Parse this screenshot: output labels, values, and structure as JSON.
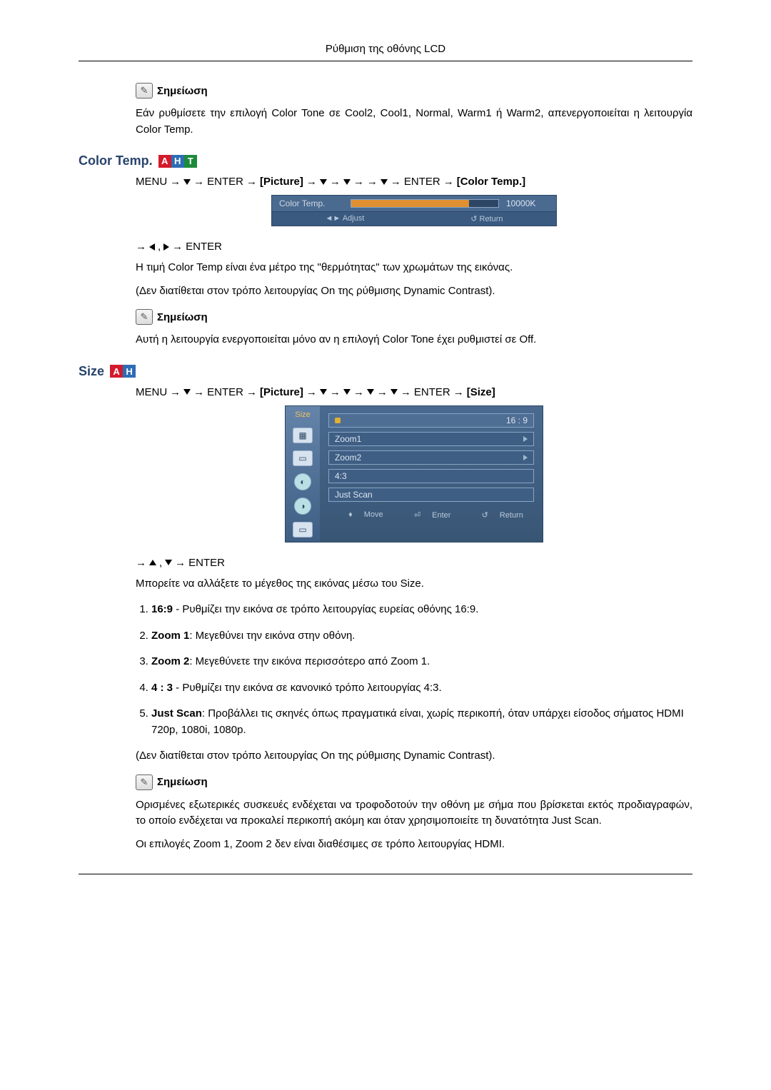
{
  "page_header": "Ρύθμιση της οθόνης LCD",
  "note_label": "Σημείωση",
  "note1_text": "Εάν ρυθμίσετε την επιλογή Color Tone σε Cool2, Cool1, Normal, Warm1 ή Warm2, απενεργοποιείται η λειτουργία Color Temp.",
  "section_colortemp": {
    "title": "Color Temp.",
    "nav": {
      "menu": "MENU",
      "enter": "ENTER",
      "picture": "Picture",
      "target": "Color Temp."
    },
    "osd": {
      "label": "Color  Temp.",
      "value": "10000K",
      "adjust": "Adjust",
      "return": "Return"
    },
    "after_nav": "ENTER",
    "desc": "Η τιμή Color Temp είναι ένα μέτρο της \"θερμότητας\" των χρωμάτων της εικόνας.",
    "restriction": "(Δεν διατίθεται στον τρόπο λειτουργίας On της ρύθμισης Dynamic Contrast).",
    "note2_text": "Αυτή η λειτουργία ενεργοποιείται μόνο αν η επιλογή Color Tone έχει ρυθμιστεί σε Off."
  },
  "section_size": {
    "title": "Size",
    "nav": {
      "menu": "MENU",
      "enter": "ENTER",
      "picture": "Picture",
      "target": "Size"
    },
    "osd": {
      "side_title": "Size",
      "options": [
        "16 : 9",
        "Zoom1",
        "Zoom2",
        "4:3",
        "Just Scan"
      ],
      "selected_index": 0,
      "move": "Move",
      "enter": "Enter",
      "return": "Return"
    },
    "after_nav": "ENTER",
    "desc": "Μπορείτε να αλλάξετε το μέγεθος της εικόνας μέσω του Size.",
    "items": [
      {
        "label": "16:9",
        "text": " - Ρυθμίζει την εικόνα σε τρόπο λειτουργίας ευρείας οθόνης 16:9."
      },
      {
        "label": "Zoom 1",
        "text": ": Μεγεθύνει την εικόνα στην οθόνη."
      },
      {
        "label": "Zoom 2",
        "text": ": Μεγεθύνετε την εικόνα περισσότερο από Zoom 1."
      },
      {
        "label": "4 : 3",
        "text": " - Ρυθμίζει την εικόνα σε κανονικό τρόπο λειτουργίας 4:3."
      },
      {
        "label": "Just Scan",
        "text": ": Προβάλλει τις σκηνές όπως πραγματικά είναι, χωρίς περικοπή, όταν υπάρχει είσοδος σήματος HDMI 720p, 1080i, 1080p."
      }
    ],
    "restriction": "(Δεν διατίθεται στον τρόπο λειτουργίας On της ρύθμισης Dynamic Contrast).",
    "note3_text": "Ορισμένες εξωτερικές συσκευές ενδέχεται να τροφοδοτούν την οθόνη με σήμα που βρίσκεται εκτός προδιαγραφών, το οποίο ενδέχεται να προκαλεί περικοπή ακόμη και όταν χρησιμοποιείτε τη δυνατότητα Just Scan.",
    "note3_text2": "Οι επιλογές Zoom 1, Zoom 2 δεν είναι διαθέσιμες σε τρόπο λειτουργίας HDMI."
  }
}
